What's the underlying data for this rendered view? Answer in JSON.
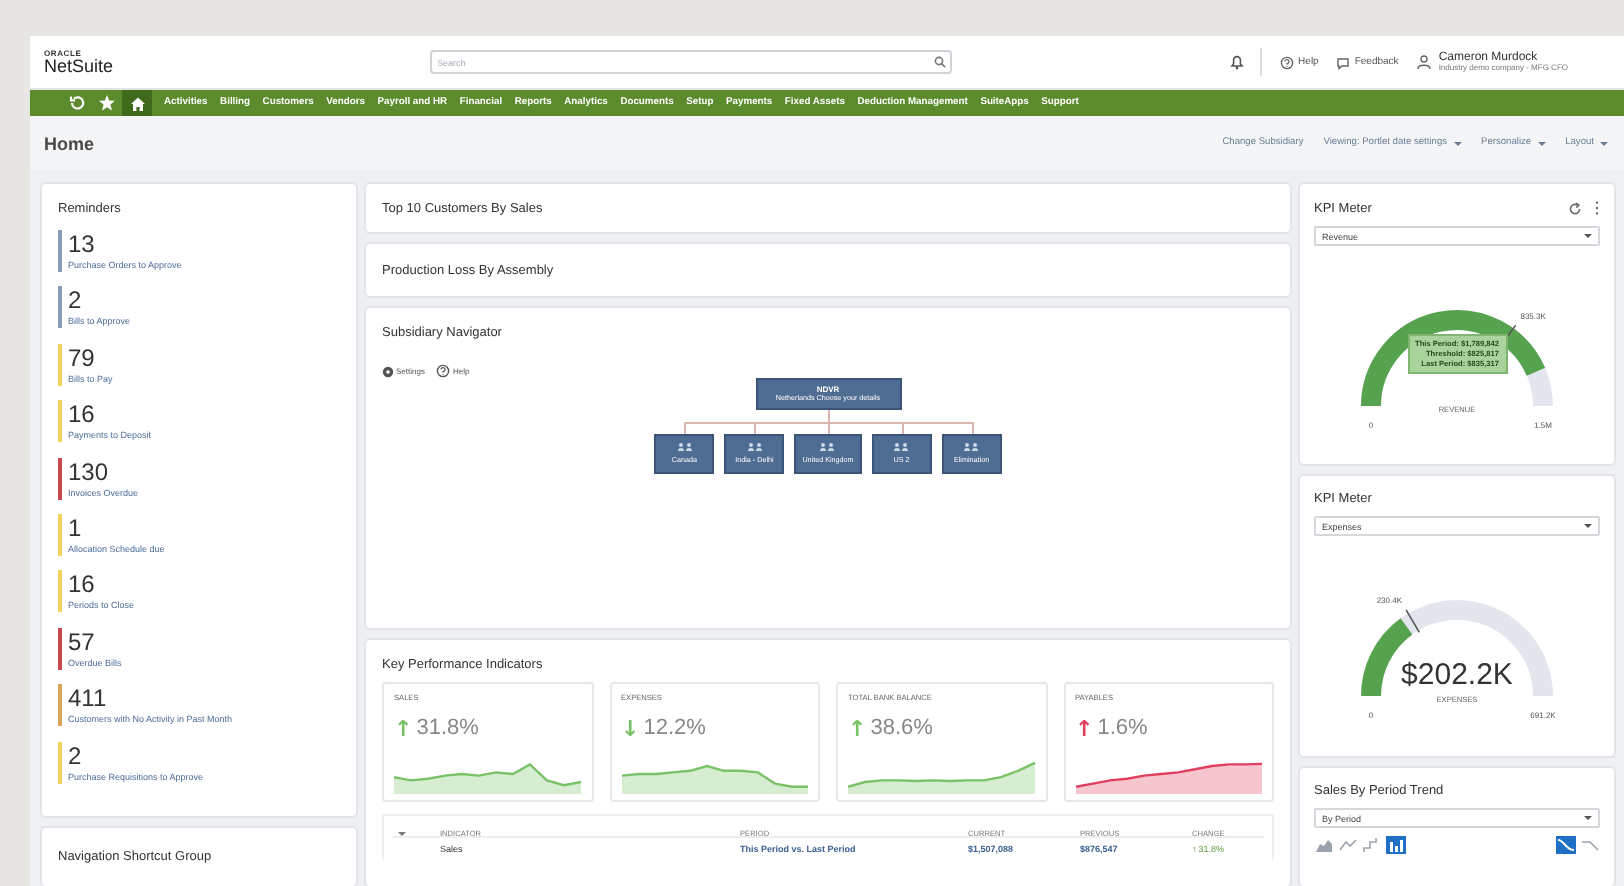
{
  "header": {
    "logo_small": "ORACLE",
    "logo": "NetSuite",
    "search": {
      "placeholder": "Search"
    },
    "links": [
      {
        "kind": "help",
        "label": "Help"
      },
      {
        "kind": "feedback",
        "label": "Feedback"
      }
    ],
    "user": {
      "name": "Cameron Murdock",
      "role": "Industry demo company - MFG CFO"
    }
  },
  "nav": {
    "items": [
      "Activities",
      "Billing",
      "Customers",
      "Vendors",
      "Payroll and HR",
      "Financial",
      "Reports",
      "Analytics",
      "Documents",
      "Setup",
      "Payments",
      "Fixed Assets",
      "Deduction Management",
      "SuiteApps",
      "Support"
    ]
  },
  "page": {
    "title": "Home",
    "actions": [
      {
        "label": "Change Subsidiary",
        "has_menu": false
      },
      {
        "label": "Viewing: Portlet date settings",
        "has_menu": true
      },
      {
        "label": "Personalize",
        "has_menu": true
      },
      {
        "label": "Layout",
        "has_menu": true
      }
    ]
  },
  "reminders": {
    "title": "Reminders",
    "items": [
      {
        "count": "13",
        "label": "Purchase Orders to Approve",
        "color": "#8a9bb5"
      },
      {
        "count": "2",
        "label": "Bills to Approve",
        "color": "#8a9bb5"
      },
      {
        "count": "79",
        "label": "Bills to Pay",
        "color": "#f2d35c"
      },
      {
        "count": "16",
        "label": "Payments to Deposit",
        "color": "#f2d35c"
      },
      {
        "count": "130",
        "label": "Invoices Overdue",
        "color": "#c9474f"
      },
      {
        "count": "1",
        "label": "Allocation Schedule due",
        "color": "#f2d35c"
      },
      {
        "count": "16",
        "label": "Periods to Close",
        "color": "#f2d35c"
      },
      {
        "count": "57",
        "label": "Overdue Bills",
        "color": "#c9474f"
      },
      {
        "count": "411",
        "label": "Customers with No Activity in Past Month",
        "color": "#d9a55b"
      },
      {
        "count": "2",
        "label": "Purchase Requisitions to Approve",
        "color": "#f2d35c"
      }
    ]
  },
  "navigation_shortcut_group": {
    "title": "Navigation Shortcut Group"
  },
  "portlets": [
    {
      "title": "Top 10 Customers By Sales"
    },
    {
      "title": "Production Loss By Assembly"
    }
  ],
  "subsidiary_navigator": {
    "title": "Subsidiary Navigator",
    "links": [
      {
        "kind": "settings",
        "label": "Settings"
      },
      {
        "kind": "help",
        "label": "Help"
      }
    ],
    "root": {
      "name": "NDVR",
      "subtitle": "Netherlands Choose your details"
    },
    "children": [
      "Canada",
      "India - Delhi",
      "United Kingdom",
      "US 2",
      "Elimination"
    ]
  },
  "kpi": {
    "title": "Key Performance Indicators",
    "cards": [
      {
        "label": "SALES",
        "arrow": "↑",
        "change": "31.8%",
        "color": "#79c267"
      },
      {
        "label": "EXPENSES",
        "arrow": "↓",
        "change": "12.2%",
        "color": "#79c267"
      },
      {
        "label": "TOTAL BANK BALANCE",
        "arrow": "↑",
        "change": "38.6%",
        "color": "#79c267"
      },
      {
        "label": "PAYABLES",
        "arrow": "↑",
        "change": "1.6%",
        "color": "#e0405e"
      }
    ],
    "table": {
      "columns": [
        "INDICATOR",
        "PERIOD",
        "CURRENT",
        "PREVIOUS",
        "CHANGE"
      ],
      "rows": [
        {
          "indicator": "Sales",
          "period": "This Period vs. Last Period",
          "current": "$1,507,088",
          "previous": "$876,547",
          "arrow": "↑",
          "change": "31.8%"
        }
      ]
    }
  },
  "kpi_meters": [
    {
      "title": "KPI Meter",
      "has_actions": true,
      "select": "Revenue",
      "marker": "835.3K",
      "min": "0",
      "max": "1.5M",
      "caption": "REVENUE",
      "tooltip": [
        "This Period: $1,789,842",
        "Threshold: $825,817",
        "Last Period: $835,317"
      ]
    },
    {
      "title": "KPI Meter",
      "has_actions": false,
      "select": "Expenses",
      "marker": "230.4K",
      "min": "0",
      "max": "691.2K",
      "value": "$202.2K",
      "caption": "EXPENSES"
    }
  ],
  "sales_trend": {
    "title": "Sales By Period Trend",
    "select": "By Period",
    "chart_types": [
      {
        "kind": "area",
        "selected": false
      },
      {
        "kind": "line",
        "selected": false
      },
      {
        "kind": "step",
        "selected": false
      },
      {
        "kind": "bar",
        "selected": true
      }
    ],
    "line_styles": [
      {
        "kind": "curve",
        "selected": true
      },
      {
        "kind": "slope",
        "selected": false
      }
    ]
  }
}
